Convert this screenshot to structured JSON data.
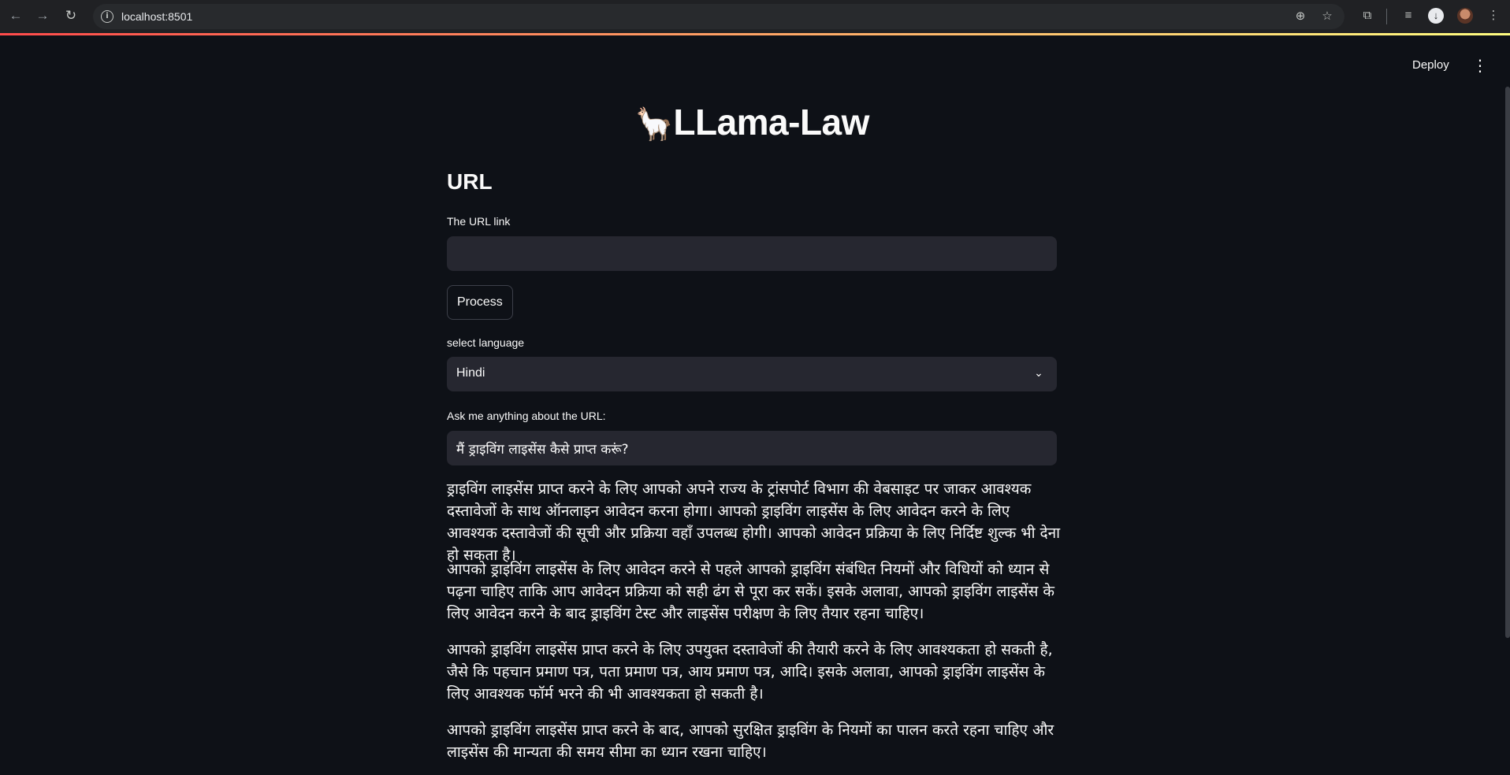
{
  "browser": {
    "url": "localhost:8501",
    "back_icon": "back-arrow-icon",
    "forward_icon": "forward-arrow-icon",
    "reload_icon": "reload-icon"
  },
  "header": {
    "deploy_label": "Deploy"
  },
  "app": {
    "title": "LLama-Law",
    "title_emoji": "🦙",
    "section_heading": "URL",
    "url_label": "The URL link",
    "url_value": "",
    "process_label": "Process",
    "language_label": "select language",
    "language_value": "Hindi",
    "question_label": "Ask me anything about the URL:",
    "question_value": "मैं ड्राइविंग लाइसेंस कैसे प्राप्त करूं?"
  },
  "answer": [
    "ड्राइविंग लाइसेंस प्राप्त करने के लिए आपको अपने राज्य के ट्रांसपोर्ट विभाग की वेबसाइट पर जाकर आवश्यक दस्तावेजों के साथ ऑनलाइन आवेदन करना होगा। आपको ड्राइविंग लाइसेंस के लिए आवेदन करने के लिए आवश्यक दस्तावेजों की सूची और प्रक्रिया वहाँ उपलब्ध होगी। आपको आवेदन प्रक्रिया के लिए निर्दिष्ट शुल्क भी देना हो सकता है।",
    "आपको ड्राइविंग लाइसेंस के लिए आवेदन करने से पहले आपको ड्राइविंग संबंधित नियमों और विधियों को ध्यान से पढ़ना चाहिए ताकि आप आवेदन प्रक्रिया को सही ढंग से पूरा कर सकें। इसके अलावा, आपको ड्राइविंग लाइसेंस के लिए आवेदन करने के बाद ड्राइविंग टेस्ट और लाइसेंस परीक्षण के लिए तैयार रहना चाहिए।",
    "आपको ड्राइविंग लाइसेंस प्राप्त करने के लिए उपयुक्त दस्तावेजों की तैयारी करने के लिए आवश्यकता हो सकती है, जैसे कि पहचान प्रमाण पत्र, पता प्रमाण पत्र, आय प्रमाण पत्र, आदि। इसके अलावा, आपको ड्राइविंग लाइसेंस के लिए आवश्यक फॉर्म भरने की भी आवश्यकता हो सकती है।",
    "आपको ड्राइविंग लाइसेंस प्राप्त करने के बाद, आपको सुरक्षित ड्राइविंग के नियमों का पालन करते रहना चाहिए और लाइसेंस की मान्यता की समय सीमा का ध्यान रखना चाहिए।"
  ]
}
